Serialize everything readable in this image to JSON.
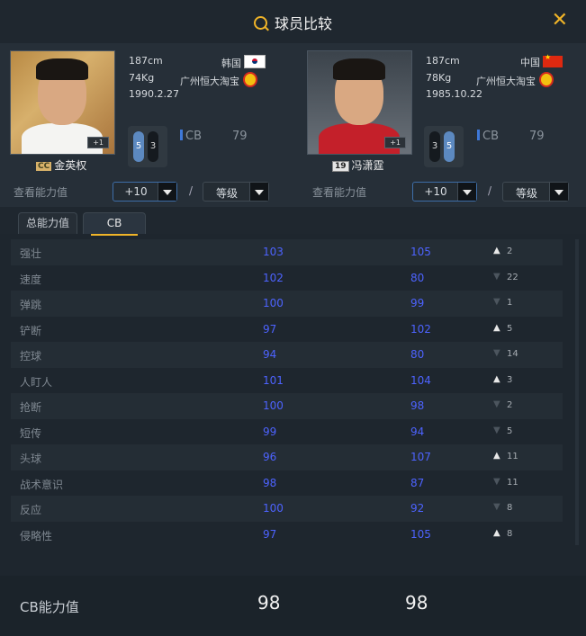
{
  "title": "球员比较",
  "player1": {
    "height": "187cm",
    "country": "韩国",
    "weight": "74Kg",
    "club": "广州恒大淘宝",
    "birth": "1990.2.27",
    "plus": "+1",
    "name": "金英权",
    "season_badge": "CC",
    "foot_left": "5",
    "foot_right": "3",
    "position": "CB",
    "ovr": "79",
    "view_label": "查看能力值",
    "boost": "+10",
    "level": "等级"
  },
  "player2": {
    "height": "187cm",
    "country": "中国",
    "weight": "78Kg",
    "club": "广州恒大淘宝",
    "birth": "1985.10.22",
    "plus": "+1",
    "name": "冯潇霆",
    "season_badge": "19",
    "foot_left": "3",
    "foot_right": "5",
    "position": "CB",
    "ovr": "79",
    "view_label": "查看能力值",
    "boost": "+10",
    "level": "等级"
  },
  "slash": "/",
  "tabs": [
    "总能力值",
    "CB"
  ],
  "rows": [
    {
      "name": "强壮",
      "v1": "103",
      "v2": "105",
      "dir": "up",
      "diff": "2"
    },
    {
      "name": "速度",
      "v1": "102",
      "v2": "80",
      "dir": "down",
      "diff": "22"
    },
    {
      "name": "弹跳",
      "v1": "100",
      "v2": "99",
      "dir": "down",
      "diff": "1"
    },
    {
      "name": "铲断",
      "v1": "97",
      "v2": "102",
      "dir": "up",
      "diff": "5"
    },
    {
      "name": "控球",
      "v1": "94",
      "v2": "80",
      "dir": "down",
      "diff": "14"
    },
    {
      "name": "人盯人",
      "v1": "101",
      "v2": "104",
      "dir": "up",
      "diff": "3"
    },
    {
      "name": "抢断",
      "v1": "100",
      "v2": "98",
      "dir": "down",
      "diff": "2"
    },
    {
      "name": "短传",
      "v1": "99",
      "v2": "94",
      "dir": "down",
      "diff": "5"
    },
    {
      "name": "头球",
      "v1": "96",
      "v2": "107",
      "dir": "up",
      "diff": "11"
    },
    {
      "name": "战术意识",
      "v1": "98",
      "v2": "87",
      "dir": "down",
      "diff": "11"
    },
    {
      "name": "反应",
      "v1": "100",
      "v2": "92",
      "dir": "down",
      "diff": "8"
    },
    {
      "name": "侵略性",
      "v1": "97",
      "v2": "105",
      "dir": "up",
      "diff": "8"
    }
  ],
  "footer": {
    "label": "CB能力值",
    "v1": "98",
    "v2": "98"
  }
}
